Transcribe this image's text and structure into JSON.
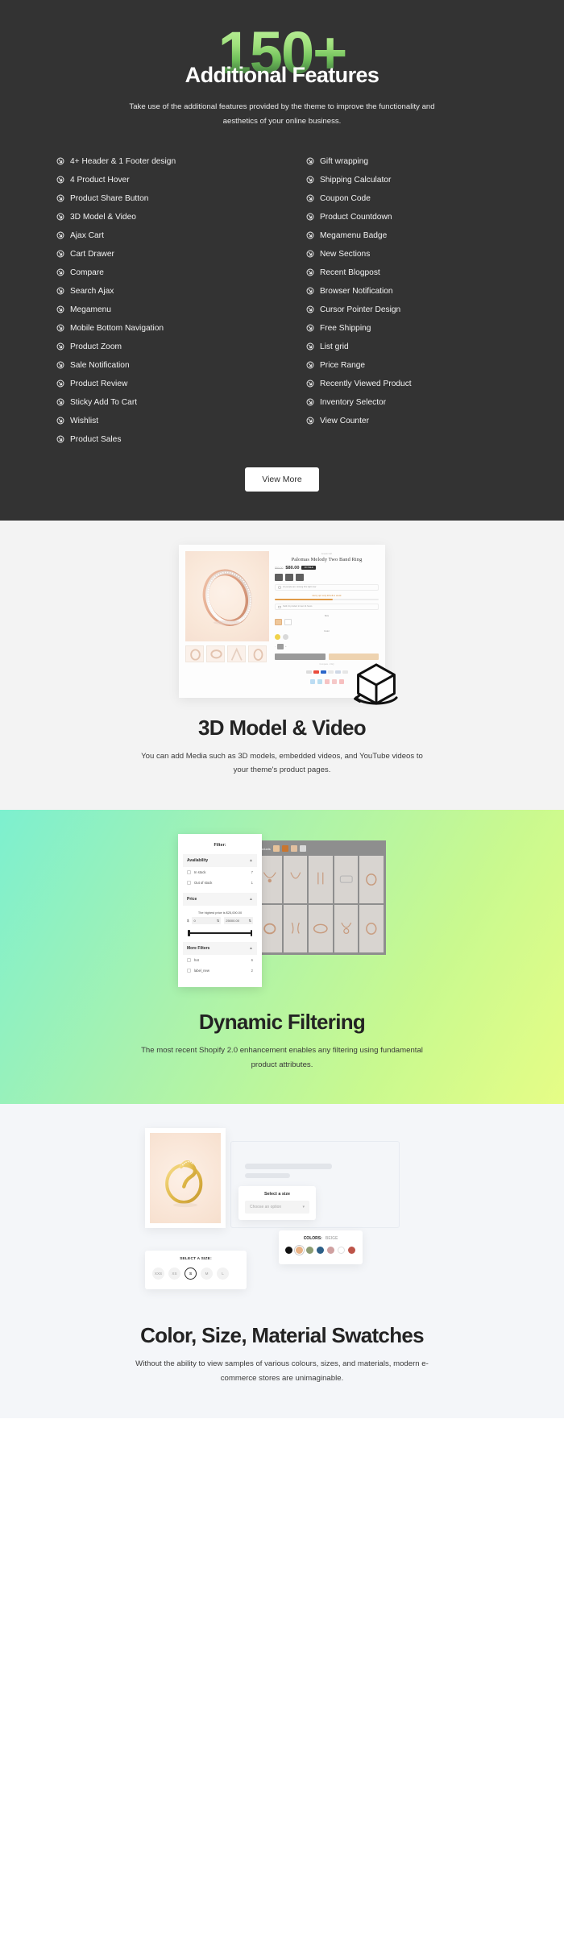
{
  "features": {
    "number": "150+",
    "headline": "Additional Features",
    "subtitle": "Take use of the additional features provided by the theme to improve the functionality and aesthetics of your online business.",
    "icon": "circle-arrow-icon",
    "left_items": [
      "4+ Header & 1 Footer design",
      "4 Product Hover",
      "Product Share Button",
      "3D Model & Video",
      "Ajax Cart",
      "Cart Drawer",
      "Compare",
      "Search Ajax",
      "Megamenu",
      "Mobile Bottom Navigation",
      "Product Zoom",
      "Sale Notification",
      "Product Review",
      "Sticky Add To Cart",
      "Wishlist",
      "Product Sales"
    ],
    "right_items": [
      "Gift wrapping",
      "Shipping Calculator",
      "Coupon Code",
      "Product Countdown",
      "Megamenu Badge",
      "New Sections",
      "Recent Blogpost",
      "Browser Notification",
      "Cursor Pointer Design",
      "Free Shipping",
      "List grid",
      "Price Range",
      "Recently Viewed Product",
      "Inventory Selector",
      "View Counter"
    ],
    "view_more_label": "View More",
    "background_color": "#333333",
    "gradient_from": "#bdf09b",
    "gradient_to": "#2f5c33"
  },
  "model3d": {
    "title": "3D Model & Video",
    "description": "You can add Media such as 3D models, embedded videos, and YouTube videos to your theme's product pages.",
    "badge_icon": "3d-cube-rotate-icon",
    "product": {
      "vendor": "Jewelcraft",
      "name": "Palomas Melody Two Band Ring",
      "old_price": "$90.00",
      "price": "$80.00",
      "sale_badge": "ON SALE",
      "stock_badge": "In stock",
      "viewers_note": "12 people are viewing this right now",
      "urgency_note": "Hurry up! only 20 left in stock",
      "delivery_note": "Sold 21 product in last 14 hours",
      "size_label": "Size",
      "color_label": "Color",
      "add_to_cart_label": "Add To Cart",
      "buy_now_label": "Buy It Now",
      "compare_label": "Compare - FAQ",
      "payment_label": "Payment methods",
      "thumbnails": 4
    }
  },
  "filtering": {
    "title": "Dynamic Filtering",
    "description": "The most recent Shopify 2.0 enhancement enables any filtering using fundamental product attributes.",
    "panel": {
      "title": "Filter:",
      "sections": [
        {
          "name": "Availability",
          "rows": [
            {
              "label": "In stock",
              "count": "7"
            },
            {
              "label": "Out of stock",
              "count": "1"
            }
          ]
        },
        {
          "name": "Price",
          "note": "The highest price is $25,000.00",
          "currency": "$",
          "min_value": "0",
          "max_value": "25000.00"
        },
        {
          "name": "More Filters",
          "rows": [
            {
              "label": "hot",
              "count": "6"
            },
            {
              "label": "label_new",
              "count": "2"
            }
          ]
        }
      ]
    },
    "grid_label": "Products"
  },
  "swatches": {
    "title": "Color, Size, Material Swatches",
    "description": "Without the ability to view samples of various colours, sizes, and materials, modern e-commerce stores are unimaginable.",
    "size_card": {
      "label": "Select a size",
      "placeholder": "Choose an option",
      "chevron": "chevron-down-icon"
    },
    "colors_card": {
      "label": "COLORS:",
      "selected": "BEIGE",
      "dots": [
        "#111111",
        "#e8b184",
        "#8a9b72",
        "#2c5f87",
        "#cfa0a0",
        "#ffffff",
        "#bd5448"
      ],
      "selected_index": 1
    },
    "sizes_card": {
      "label": "SELECT A SIZE:",
      "options": [
        "XXS",
        "XS",
        "S",
        "M",
        "L"
      ],
      "selected": "S"
    }
  }
}
